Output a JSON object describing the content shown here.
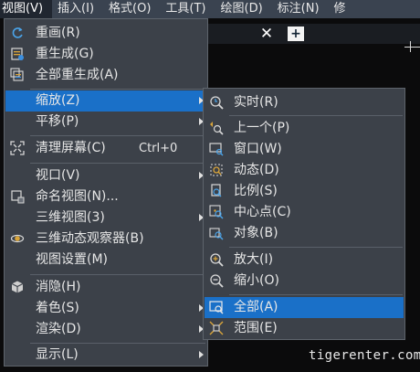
{
  "menubar": {
    "items": [
      "视图(V)",
      "插入(I)",
      "格式(O)",
      "工具(T)",
      "绘图(D)",
      "标注(N)",
      "修"
    ]
  },
  "tab": {
    "close_symbol": "✕",
    "add_symbol": "+"
  },
  "view_menu": {
    "items": [
      {
        "label": "重画(R)",
        "icon": "redraw-icon"
      },
      {
        "label": "重生成(G)",
        "icon": "regen-icon"
      },
      {
        "label": "全部重生成(A)",
        "icon": "regen-all-icon"
      },
      {
        "label": "缩放(Z)",
        "submenu": true
      },
      {
        "label": "平移(P)",
        "submenu": true
      },
      {
        "label": "清理屏幕(C)",
        "shortcut": "Ctrl+0",
        "icon": "clean-screen-icon"
      },
      {
        "label": "视口(V)",
        "submenu": true
      },
      {
        "label": "命名视图(N)...",
        "icon": "named-view-icon"
      },
      {
        "label": "三维视图(3)",
        "submenu": true
      },
      {
        "label": "三维动态观察器(B)",
        "icon": "3d-orbit-icon"
      },
      {
        "label": "视图设置(M)"
      },
      {
        "label": "消隐(H)",
        "icon": "hide-icon"
      },
      {
        "label": "着色(S)",
        "submenu": true
      },
      {
        "label": "渲染(D)",
        "submenu": true
      },
      {
        "label": "显示(L)",
        "submenu": true
      }
    ]
  },
  "zoom_submenu": {
    "items": [
      {
        "label": "实时(R)",
        "icon": "zoom-realtime-icon"
      },
      {
        "label": "上一个(P)",
        "icon": "zoom-previous-icon"
      },
      {
        "label": "窗口(W)",
        "icon": "zoom-window-icon"
      },
      {
        "label": "动态(D)",
        "icon": "zoom-dynamic-icon"
      },
      {
        "label": "比例(S)",
        "icon": "zoom-scale-icon"
      },
      {
        "label": "中心点(C)",
        "icon": "zoom-center-icon"
      },
      {
        "label": "对象(B)",
        "icon": "zoom-object-icon"
      },
      {
        "label": "放大(I)",
        "icon": "zoom-in-icon"
      },
      {
        "label": "缩小(O)",
        "icon": "zoom-out-icon"
      },
      {
        "label": "全部(A)",
        "icon": "zoom-all-icon"
      },
      {
        "label": "范围(E)",
        "icon": "zoom-extents-icon"
      }
    ]
  },
  "watermark": "tigerenter.com",
  "colors": {
    "highlight": "#1a70c8",
    "menu_bg": "#3c4149",
    "menubar_bg": "#3a4350"
  }
}
